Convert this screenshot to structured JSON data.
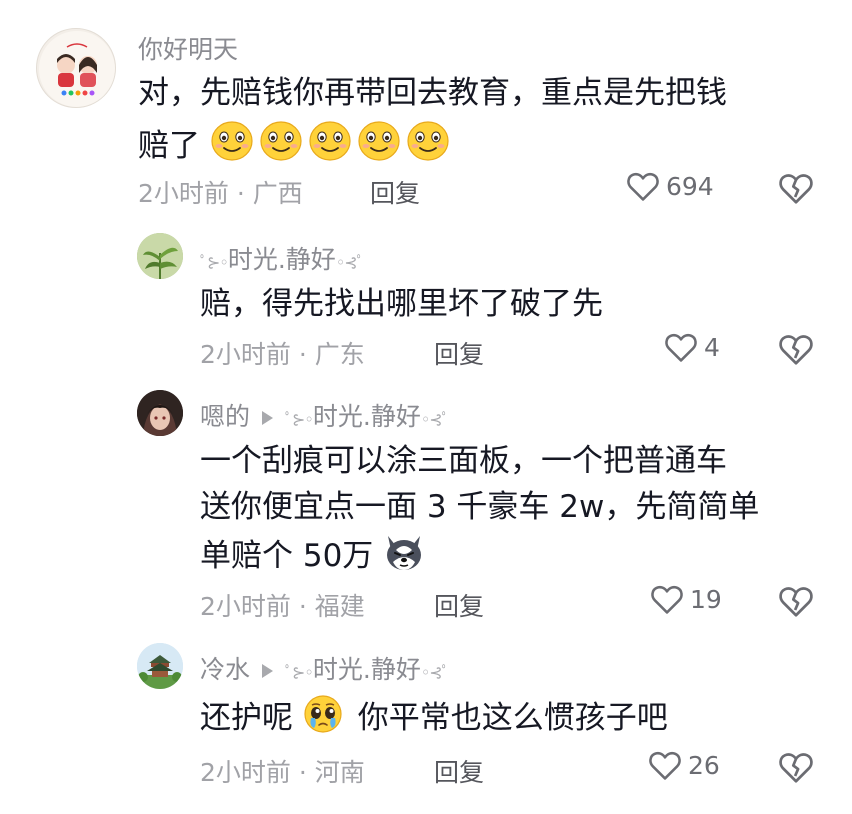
{
  "comments": [
    {
      "username": "你好明天",
      "text_line1": "对，先赔钱你再带回去教育，重点是先把钱",
      "text_line2": "赔了",
      "emoji_count": 5,
      "time": "2小时前 · 广西",
      "reply_label": "回复",
      "likes": "694"
    },
    {
      "username": "时光.静好",
      "text": "赔，得先找出哪里坏了破了先",
      "time": "2小时前 · 广东",
      "reply_label": "回复",
      "likes": "4"
    },
    {
      "username": "嗯的",
      "reply_to": "时光.静好",
      "text_line1": "一个刮痕可以涂三面板，一个把普通车",
      "text_line2": "送你便宜点一面 3 千豪车 2w，先简简单",
      "text_line3": "单赔个 50万",
      "time": "2小时前 · 福建",
      "reply_label": "回复",
      "likes": "19"
    },
    {
      "username": "冷水",
      "reply_to": "时光.静好",
      "text_a": "还护呢",
      "text_b": "你平常也这么惯孩子吧",
      "time": "2小时前 · 河南",
      "reply_label": "回复",
      "likes": "26"
    }
  ],
  "icons": {
    "like": "heart-outline-icon",
    "dislike": "broken-heart-icon",
    "emoji_smile": "smiling-face-icon",
    "emoji_dog": "husky-face-icon",
    "emoji_plead": "pleading-face-icon"
  },
  "colors": {
    "text": "#161823",
    "muted": "#a1a2a7",
    "name": "#8a8b91",
    "emoji_yellow": "#ffd23a"
  }
}
